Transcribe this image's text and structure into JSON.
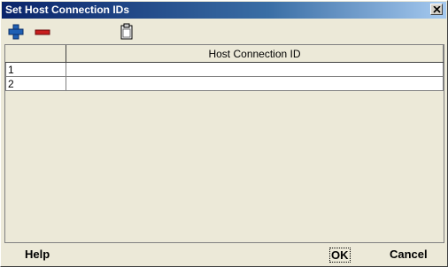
{
  "window": {
    "title": "Set Host Connection IDs"
  },
  "toolbar": {
    "add_icon": "plus-icon",
    "remove_icon": "minus-icon",
    "paste_icon": "clipboard-icon"
  },
  "table": {
    "header": "Host Connection ID",
    "rows": [
      {
        "index": "1",
        "value": ""
      },
      {
        "index": "2",
        "value": ""
      }
    ]
  },
  "buttons": {
    "help": "Help",
    "ok": "OK",
    "cancel": "Cancel"
  },
  "colors": {
    "titlebar_start": "#0a246a",
    "titlebar_end": "#a6caf0",
    "add": "#1e5fb4",
    "remove": "#c81e1e"
  }
}
